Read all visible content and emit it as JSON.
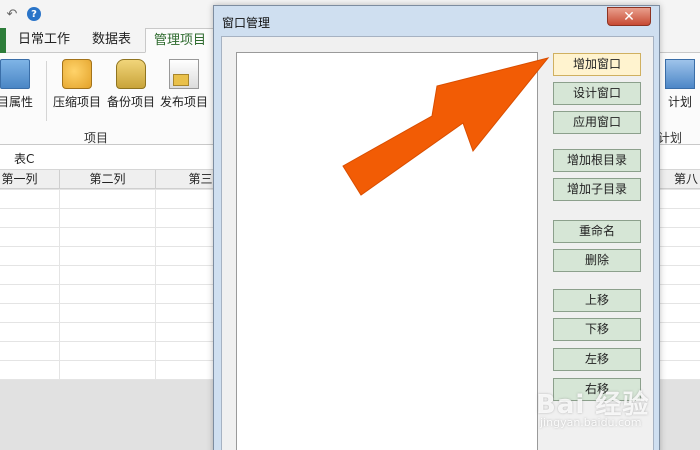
{
  "app": {
    "tabs": [
      "日常工作",
      "数据表",
      "管理项目"
    ],
    "ribbon": {
      "buttons": [
        "目属性",
        "压缩项目",
        "备份项目",
        "发布项目",
        "计划"
      ],
      "group_label": "项目",
      "group_label_right": "计划"
    },
    "sheet_name": "表C",
    "columns": [
      "第一列",
      "第二列",
      "第三",
      "第八"
    ],
    "icons": [
      "undo-icon",
      "help-icon",
      "properties-icon",
      "compress-icon",
      "backup-icon",
      "publish-icon",
      "plan-icon"
    ]
  },
  "dialog": {
    "title": "窗口管理",
    "close_symbol": "✕",
    "buttons": [
      {
        "label": "增加窗口",
        "state": "active"
      },
      {
        "label": "设计窗口"
      },
      {
        "label": "应用窗口"
      },
      {
        "label": "增加根目录"
      },
      {
        "label": "增加子目录"
      },
      {
        "label": "重命名"
      },
      {
        "label": "删除"
      },
      {
        "label": "上移"
      },
      {
        "label": "下移"
      },
      {
        "label": "左移"
      },
      {
        "label": "右移"
      }
    ]
  },
  "colors": {
    "arrow": "#f25c05",
    "active_button": "#fff3cf",
    "button": "#d6e6d6",
    "dialog_frame": "#cfdff0",
    "file_tab": "#2d7d3a"
  },
  "watermark": {
    "logo": "Bai 经验",
    "url": "jingyan.baidu.com"
  }
}
